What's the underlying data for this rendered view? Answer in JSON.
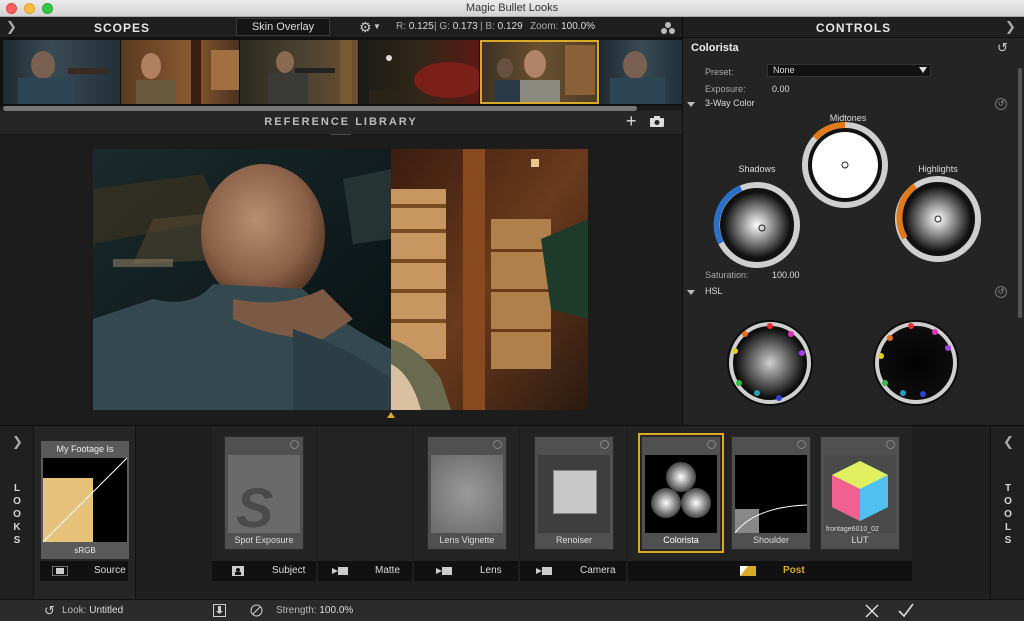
{
  "window": {
    "title": "Magic Bullet Looks"
  },
  "scopes": {
    "title": "SCOPES",
    "skin_overlay": "Skin Overlay",
    "r": "0.125",
    "g": "0.173",
    "b": "0.129",
    "r_label": "R:",
    "g_label": "| G:",
    "b_label": "| B:",
    "zoom_label": "Zoom:",
    "zoom": "100.0%"
  },
  "reference_library": {
    "title": "REFERENCE LIBRARY"
  },
  "controls": {
    "title": "CONTROLS",
    "tool_name": "Colorista",
    "preset_label": "Preset:",
    "preset_value": "None",
    "exposure_label": "Exposure:",
    "exposure_value": "0.00",
    "section_3way": "3-Way Color",
    "wheels": {
      "midtones": "Midtones",
      "shadows": "Shadows",
      "highlights": "Highlights"
    },
    "saturation_label": "Saturation:",
    "saturation_value": "100.00",
    "section_hsl": "HSL"
  },
  "looks": {
    "side_label": "L O O K S",
    "source_caption": "My Footage Is",
    "source_space": "sRGB",
    "source_footer": "Source"
  },
  "tools": {
    "side_label": "T O O L S",
    "cards": [
      {
        "name": "Spot Exposure"
      },
      {
        "name": "Lens Vignette"
      },
      {
        "name": "Renoiser"
      },
      {
        "name": "Colorista"
      },
      {
        "name": "Shoulder"
      },
      {
        "name": "LUT",
        "sublabel": "frontage6010_02"
      }
    ],
    "lanes": [
      "Subject",
      "Matte",
      "Lens",
      "Camera",
      "Post"
    ]
  },
  "status": {
    "look_label": "Look:",
    "look_value": "Untitled",
    "strength_label": "Strength:",
    "strength_value": "100.0%"
  },
  "colors": {
    "accent": "#d9a928"
  }
}
